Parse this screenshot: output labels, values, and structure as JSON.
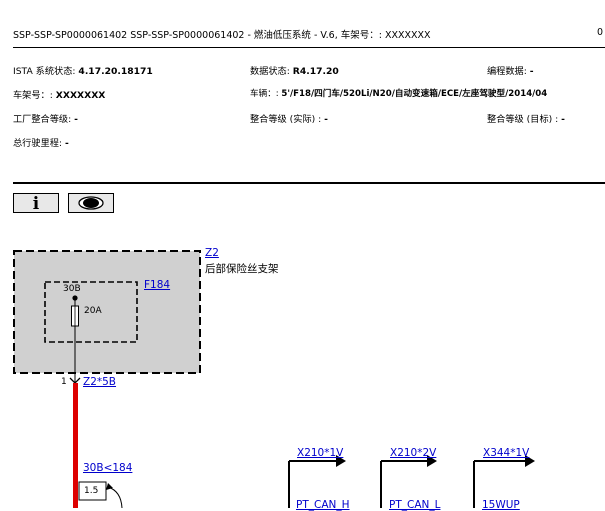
{
  "header": {
    "title": "SSP-SSP-SP0000061402 SSP-SSP-SP0000061402 - 燃油低压系统 - V.6, 车架号：: XXXXXXX",
    "page_number": "0"
  },
  "info": {
    "ista_label": "ISTA 系统状态: ",
    "ista_value": "4.17.20.18171",
    "data_label": "数据状态: ",
    "data_value": "R4.17.20",
    "prog_label": "编程数据: ",
    "prog_value": "-",
    "vin_label": "车架号：: ",
    "vin_value": "XXXXXXX",
    "vehicle_label": "车辆：: ",
    "vehicle_value": "5'/F18/四门车/520Li/N20/自动变速箱/ECE/左座驾驶型/2014/04",
    "factory_label": "工厂整合等级: ",
    "factory_value": "-",
    "actual_label": "整合等级 (实际) : ",
    "actual_value": "-",
    "target_label": "整合等级 (目标) : ",
    "target_value": "-",
    "mileage_label": "总行驶里程: ",
    "mileage_value": "-"
  },
  "toolbar": {
    "info_icon": "info-icon",
    "eye_icon": "eye-icon"
  },
  "diagram": {
    "z2_link": "Z2",
    "z2_desc": "后部保险丝支架",
    "f184_link": "F184",
    "terminal_30b": "30B",
    "fuse_rating": "20A",
    "pin_1": "1",
    "z2_5b_link": "Z2*5B",
    "wire_30b_link": "30B<184",
    "wire_size": "1.5",
    "x210_1v_link": "X210*1V",
    "x210_2v_link": "X210*2V",
    "x344_1v_link": "X344*1V",
    "pt_can_h": "PT_CAN_H",
    "pt_can_l": "PT_CAN_L",
    "wup": "15WUP"
  }
}
